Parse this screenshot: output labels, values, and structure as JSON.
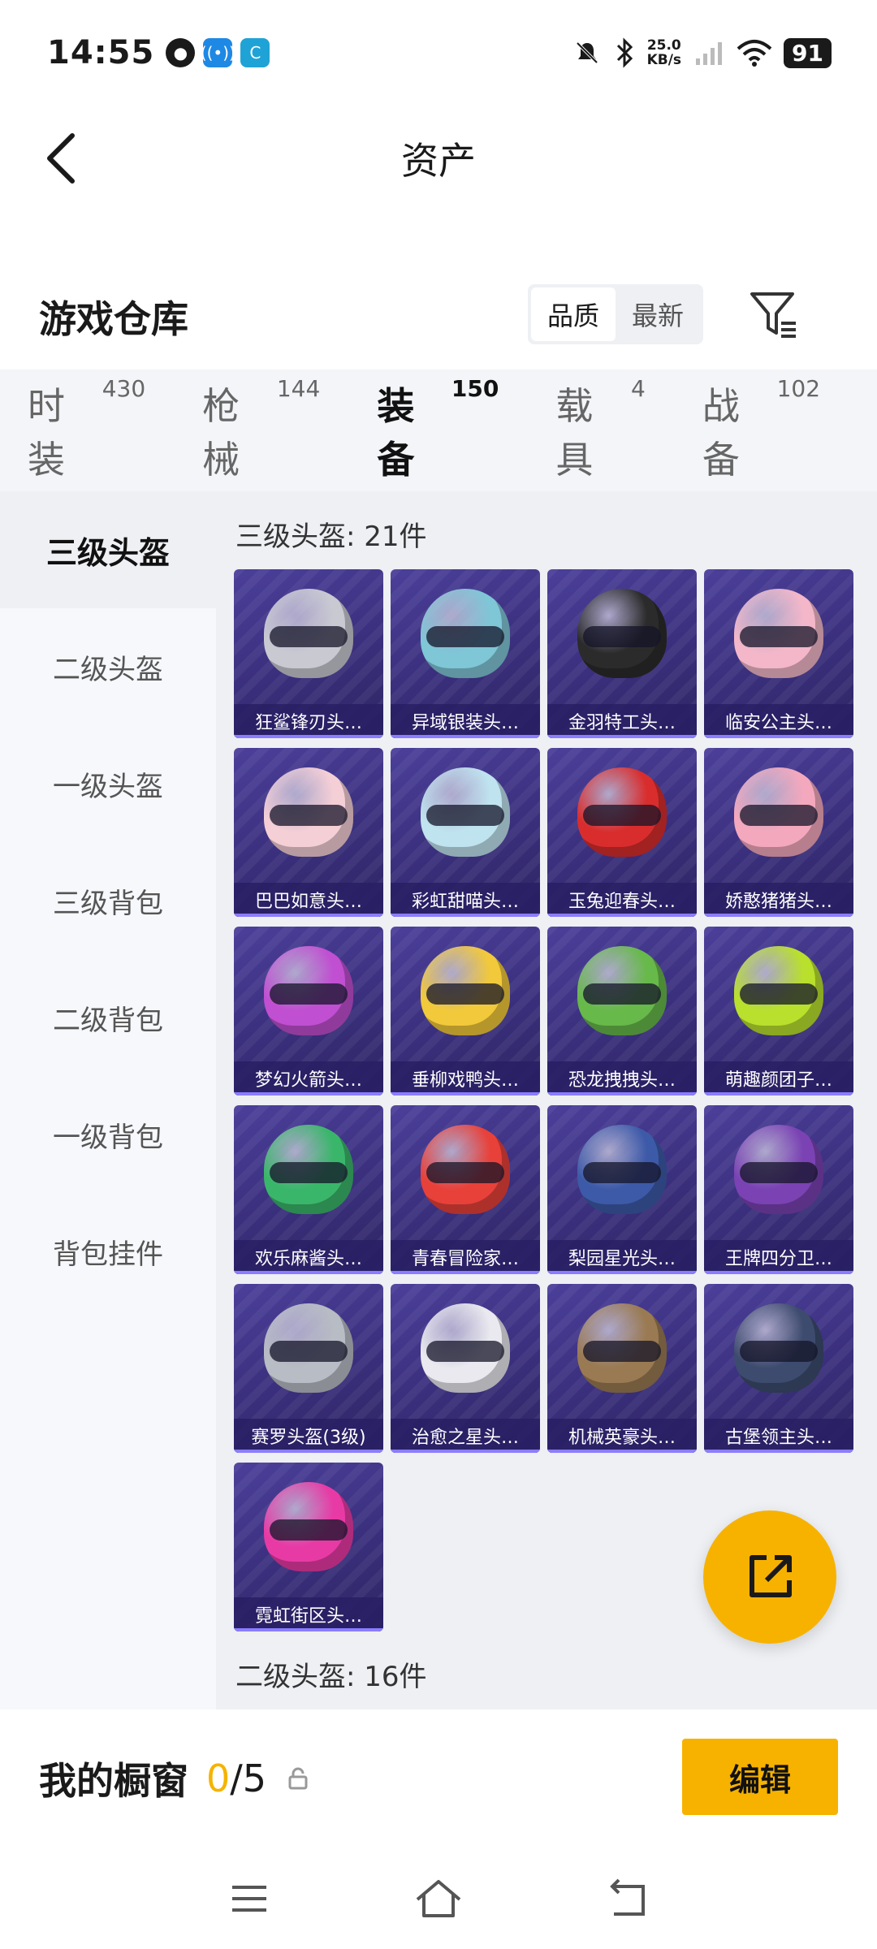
{
  "status": {
    "time": "14:55",
    "speed_value": "25.0",
    "speed_unit": "KB/s",
    "battery": "91"
  },
  "header": {
    "title": "资产"
  },
  "warehouse": {
    "title": "游戏仓库",
    "sort_options": [
      "品质",
      "最新"
    ],
    "active_sort": 0
  },
  "tabs": [
    {
      "label": "时装",
      "count": "430"
    },
    {
      "label": "枪械",
      "count": "144"
    },
    {
      "label": "装备",
      "count": "150"
    },
    {
      "label": "载具",
      "count": "4"
    },
    {
      "label": "战备",
      "count": "102"
    }
  ],
  "active_tab": 2,
  "sidenav": [
    "三级头盔",
    "二级头盔",
    "一级头盔",
    "三级背包",
    "二级背包",
    "一级背包",
    "背包挂件"
  ],
  "section": {
    "title": "三级头盔: 21件",
    "next_title": "二级头盔: 16件"
  },
  "items": [
    {
      "name": "狂鲨锋刃头…",
      "color": "#c9c9d2"
    },
    {
      "name": "异域银装头…",
      "color": "#7fc6d6"
    },
    {
      "name": "金羽特工头…",
      "color": "#2b2b2b"
    },
    {
      "name": "临安公主头…",
      "color": "#f3b7c9"
    },
    {
      "name": "巴巴如意头…",
      "color": "#f5cfd6"
    },
    {
      "name": "彩虹甜喵头…",
      "color": "#bfe3ef"
    },
    {
      "name": "玉兔迎春头…",
      "color": "#d92d2d"
    },
    {
      "name": "娇憨猪猪头…",
      "color": "#f4a8bd"
    },
    {
      "name": "梦幻火箭头…",
      "color": "#c04fd1"
    },
    {
      "name": "垂柳戏鸭头…",
      "color": "#f2c93a"
    },
    {
      "name": "恐龙拽拽头…",
      "color": "#67b94a"
    },
    {
      "name": "萌趣颜团子…",
      "color": "#b9e02c"
    },
    {
      "name": "欢乐麻酱头…",
      "color": "#3ab66a"
    },
    {
      "name": "青春冒险家…",
      "color": "#e8413a"
    },
    {
      "name": "梨园星光头…",
      "color": "#3d5aa8"
    },
    {
      "name": "王牌四分卫…",
      "color": "#7a42b3"
    },
    {
      "name": "赛罗头盔(3级)",
      "color": "#b8bcc4"
    },
    {
      "name": "治愈之星头…",
      "color": "#e9e9ef"
    },
    {
      "name": "机械英豪头…",
      "color": "#9a7a52"
    },
    {
      "name": "古堡领主头…",
      "color": "#3d4b6e"
    },
    {
      "name": "霓虹街区头…",
      "color": "#e83aa5"
    }
  ],
  "showcase": {
    "label": "我的橱窗",
    "current": "0",
    "total": "/5",
    "edit_label": "编辑"
  }
}
